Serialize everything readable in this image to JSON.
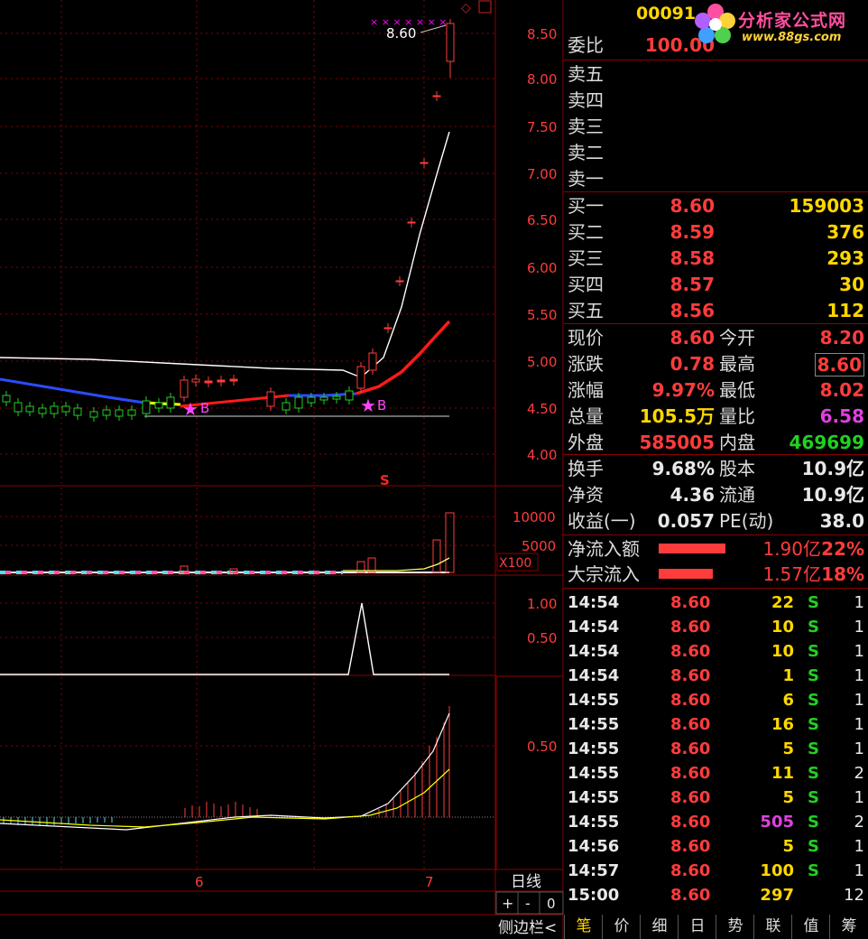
{
  "chart": {
    "price_axis_ticks": [
      "8.50",
      "8.00",
      "7.50",
      "7.00",
      "6.50",
      "6.00",
      "5.50",
      "5.00",
      "4.50",
      "4.00"
    ],
    "last_price_label": "8.60",
    "volume_axis_ticks": [
      "10000",
      "5000"
    ],
    "volume_unit": "X100",
    "indicator_ticks_1": [
      "1.00",
      "0.50"
    ],
    "indicator_ticks_2": [
      "0.50"
    ],
    "date_labels": [
      "6",
      "7"
    ],
    "period_label": "日线",
    "zoom_in": "+",
    "zoom_out": "-",
    "zoom_value": "0",
    "sidebar_toggle": "侧边栏<",
    "marker_buy": "B",
    "marker_s": "S",
    "colors": {
      "up": "#ff3c3c",
      "down": "#22d022",
      "ma_blue": "#2b4bff",
      "ma_red": "#ff1a1a",
      "boll": "#ffffff"
    }
  },
  "quote": {
    "code": "00091",
    "logo_text": "分析家公式网",
    "logo_url": "www.88gs.com",
    "weibi_label": "委比",
    "weibi_value": "100.00",
    "sell_labels": [
      "卖五",
      "卖四",
      "卖三",
      "卖二",
      "卖一"
    ],
    "bids": [
      {
        "label": "买一",
        "price": "8.60",
        "vol": "159003"
      },
      {
        "label": "买二",
        "price": "8.59",
        "vol": "376"
      },
      {
        "label": "买三",
        "price": "8.58",
        "vol": "293"
      },
      {
        "label": "买四",
        "price": "8.57",
        "vol": "30"
      },
      {
        "label": "买五",
        "price": "8.56",
        "vol": "112"
      }
    ],
    "stats": [
      {
        "l1": "现价",
        "v1": "8.60",
        "c1": "red",
        "l2": "今开",
        "v2": "8.20",
        "c2": "red"
      },
      {
        "l1": "涨跌",
        "v1": "0.78",
        "c1": "red",
        "l2": "最高",
        "v2": "8.60",
        "c2": "red"
      },
      {
        "l1": "涨幅",
        "v1": "9.97%",
        "c1": "red",
        "l2": "最低",
        "v2": "8.02",
        "c2": "red"
      },
      {
        "l1": "总量",
        "v1": "105.5万",
        "c1": "yel",
        "l2": "量比",
        "v2": "6.58",
        "c2": "mag"
      },
      {
        "l1": "外盘",
        "v1": "585005",
        "c1": "red",
        "l2": "内盘",
        "v2": "469699",
        "c2": "grn"
      }
    ],
    "fund": [
      {
        "l1": "换手",
        "v1": "9.68%",
        "l2": "股本",
        "v2": "10.9亿"
      },
      {
        "l1": "净资",
        "v1": "4.36",
        "l2": "流通",
        "v2": "10.9亿"
      },
      {
        "l1": "收益(一)",
        "v1": "0.057",
        "l2": "PE(动)",
        "v2": "38.0"
      }
    ],
    "flows": [
      {
        "label": "净流入额",
        "value": "1.90亿",
        "pct": "22%"
      },
      {
        "label": "大宗流入",
        "value": "1.57亿",
        "pct": "18%"
      }
    ]
  },
  "ticks": [
    {
      "time": "14:54",
      "price": "8.60",
      "vol": "22",
      "vc": "yel",
      "side": "S",
      "cnt": "1"
    },
    {
      "time": "14:54",
      "price": "8.60",
      "vol": "10",
      "vc": "yel",
      "side": "S",
      "cnt": "1"
    },
    {
      "time": "14:54",
      "price": "8.60",
      "vol": "10",
      "vc": "yel",
      "side": "S",
      "cnt": "1"
    },
    {
      "time": "14:54",
      "price": "8.60",
      "vol": "1",
      "vc": "yel",
      "side": "S",
      "cnt": "1"
    },
    {
      "time": "14:55",
      "price": "8.60",
      "vol": "6",
      "vc": "yel",
      "side": "S",
      "cnt": "1"
    },
    {
      "time": "14:55",
      "price": "8.60",
      "vol": "16",
      "vc": "yel",
      "side": "S",
      "cnt": "1"
    },
    {
      "time": "14:55",
      "price": "8.60",
      "vol": "5",
      "vc": "yel",
      "side": "S",
      "cnt": "1"
    },
    {
      "time": "14:55",
      "price": "8.60",
      "vol": "11",
      "vc": "yel",
      "side": "S",
      "cnt": "2"
    },
    {
      "time": "14:55",
      "price": "8.60",
      "vol": "5",
      "vc": "yel",
      "side": "S",
      "cnt": "1"
    },
    {
      "time": "14:55",
      "price": "8.60",
      "vol": "505",
      "vc": "mag",
      "side": "S",
      "cnt": "2"
    },
    {
      "time": "14:56",
      "price": "8.60",
      "vol": "5",
      "vc": "yel",
      "side": "S",
      "cnt": "1"
    },
    {
      "time": "14:57",
      "price": "8.60",
      "vol": "100",
      "vc": "yel",
      "side": "S",
      "cnt": "1"
    },
    {
      "time": "15:00",
      "price": "8.60",
      "vol": "297",
      "vc": "yel",
      "side": "",
      "cnt": "12"
    }
  ],
  "tabs": [
    "笔",
    "价",
    "细",
    "日",
    "势",
    "联",
    "值",
    "筹"
  ]
}
